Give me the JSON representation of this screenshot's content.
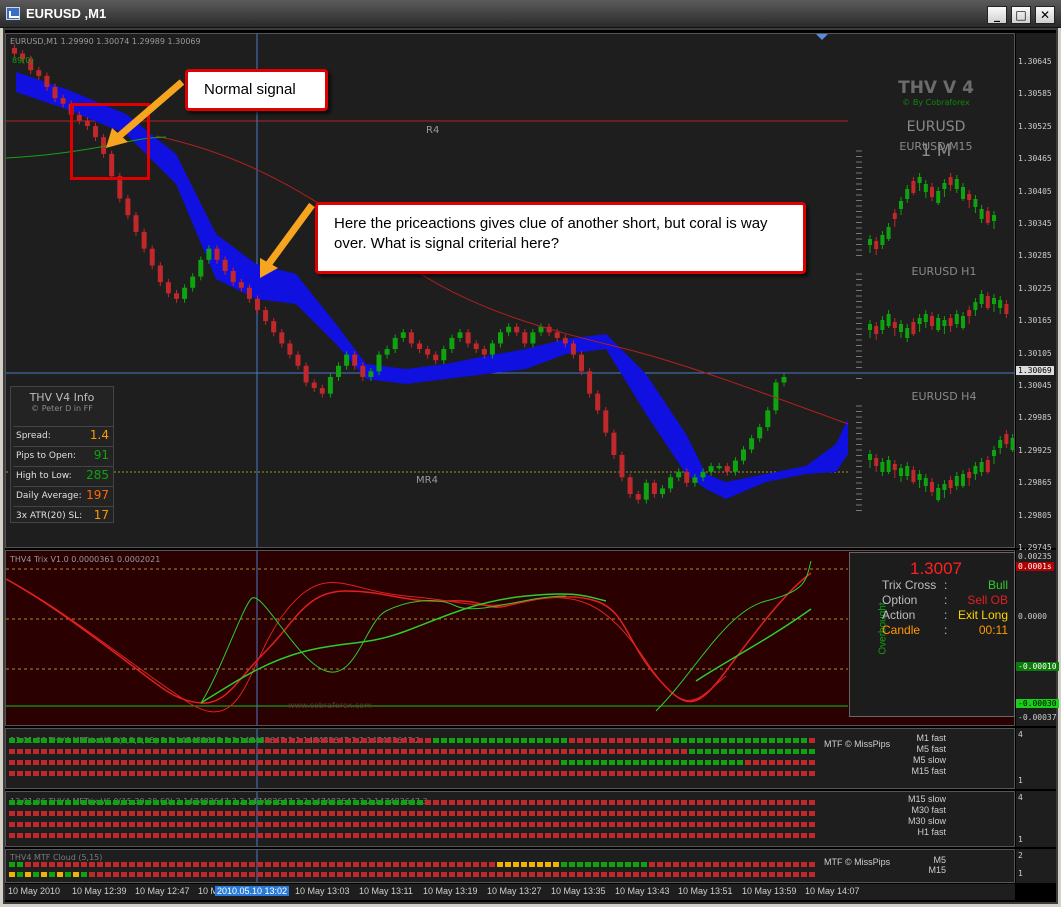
{
  "window": {
    "title": "EURUSD ,M1"
  },
  "main_chart": {
    "header": "EURUSD,M1  1.29990 1.30074 1.29989 1.30069",
    "indicator_tag": "89(0)",
    "r4_label": "R4",
    "mr4_label": "MR4",
    "current_price": "1.30069"
  },
  "price_scale": [
    "1.30645",
    "1.30585",
    "1.30525",
    "1.30465",
    "1.30405",
    "1.30345",
    "1.30285",
    "1.30225",
    "1.30165",
    "1.30105",
    "1.30045",
    "1.29985",
    "1.29925",
    "1.29865",
    "1.29805",
    "1.29745"
  ],
  "thv": {
    "title": "THV V 4",
    "credit": "© By Cobraforex",
    "symbol": "EURUSD",
    "timeframe": "1 M",
    "m15_label": "EURUSD M15",
    "h1_label": "EURUSD H1",
    "h4_label": "EURUSD H4"
  },
  "info_panel": {
    "title": "THV  V4  Info",
    "credit": "© Peter D in FF",
    "rows": [
      {
        "label": "Spread:",
        "value": "1.4",
        "color": "#ff9a00"
      },
      {
        "label": "Pips to Open:",
        "value": "91",
        "color": "#0fa30f"
      },
      {
        "label": "High to Low:",
        "value": "285",
        "color": "#0fa30f"
      },
      {
        "label": "Daily Average:",
        "value": "197",
        "color": "#ff6a00"
      },
      {
        "label": "3x ATR(20) SL:",
        "value": "17",
        "color": "#ff9a00"
      }
    ]
  },
  "callouts": {
    "normal": "Normal signal",
    "question": "Here the priceactions gives clue of another short, but coral is way over. What is signal criterial here?"
  },
  "trix": {
    "header": "THV4 Trix V1.0 0.0000361 0.0002021",
    "watermark": "www.cobraforex.com",
    "price": "1.3007",
    "status": "Overbought",
    "rows": [
      {
        "label": "Trix Cross",
        "value": "Bull",
        "label_color": "#bdbdbd",
        "value_color": "#2ecc2e"
      },
      {
        "label": "Option",
        "value": "Sell OB",
        "label_color": "#bdbdbd",
        "value_color": "#e02020"
      },
      {
        "label": "Action",
        "value": "Exit Long",
        "label_color": "#bdbdbd",
        "value_color": "#ffd400"
      },
      {
        "label": "Candle",
        "value": "00:11",
        "label_color": "#ff9a00",
        "value_color": "#ff9a00"
      }
    ],
    "scale": {
      "top": "0.00235",
      "upper_box": "0.0001s",
      "zero": "0.0000",
      "lower_box": "-0.00010",
      "bottom_box": "-0.00030",
      "bottom": "-0.00037"
    }
  },
  "mtf1": {
    "header": "13:01:06 THV4 MFTrix V6.0(1,5,5,15) 3 2.147483647 3 2.147483647 3 2.147483647 3 2.147483647 2",
    "credit": "MTF © MissPips",
    "labels": [
      "M1 fast",
      "M5 fast",
      "M5 slow",
      "M15 fast"
    ],
    "scale_top": "4",
    "scale_bottom": "1"
  },
  "mtf2": {
    "header": "13:01:06 THV4 MFTrix V6.0(15,30,30,60) 2.147483647 3 2.147483647 3 2.147483647 3 2.147483647 3",
    "labels": [
      "M15 slow",
      "M30 fast",
      "M30 slow",
      "H1 fast"
    ],
    "scale_top": "4",
    "scale_bottom": "1"
  },
  "mtf3": {
    "header": "THV4 MTF Cloud (5,15)",
    "credit": "MTF © MissPips",
    "labels": [
      "M5",
      "M15"
    ],
    "scale_top": "2",
    "scale_bottom": "1"
  },
  "x_axis": {
    "labels": [
      "10 May 2010",
      "10 May 12:39",
      "10 May 12:47",
      "10 M",
      "10 May 13:03",
      "10 May 13:11",
      "10 May 13:19",
      "10 May 13:27",
      "10 May 13:35",
      "10 May 13:43",
      "10 May 13:51",
      "10 May 13:59",
      "10 May 14:07"
    ],
    "cursor_label": "2010.05.10 13:02"
  },
  "colors": {
    "bull": "#0fa30f",
    "bear": "#c0282b",
    "cloud": "#1010e0",
    "trix_bg": "#2a0000"
  }
}
